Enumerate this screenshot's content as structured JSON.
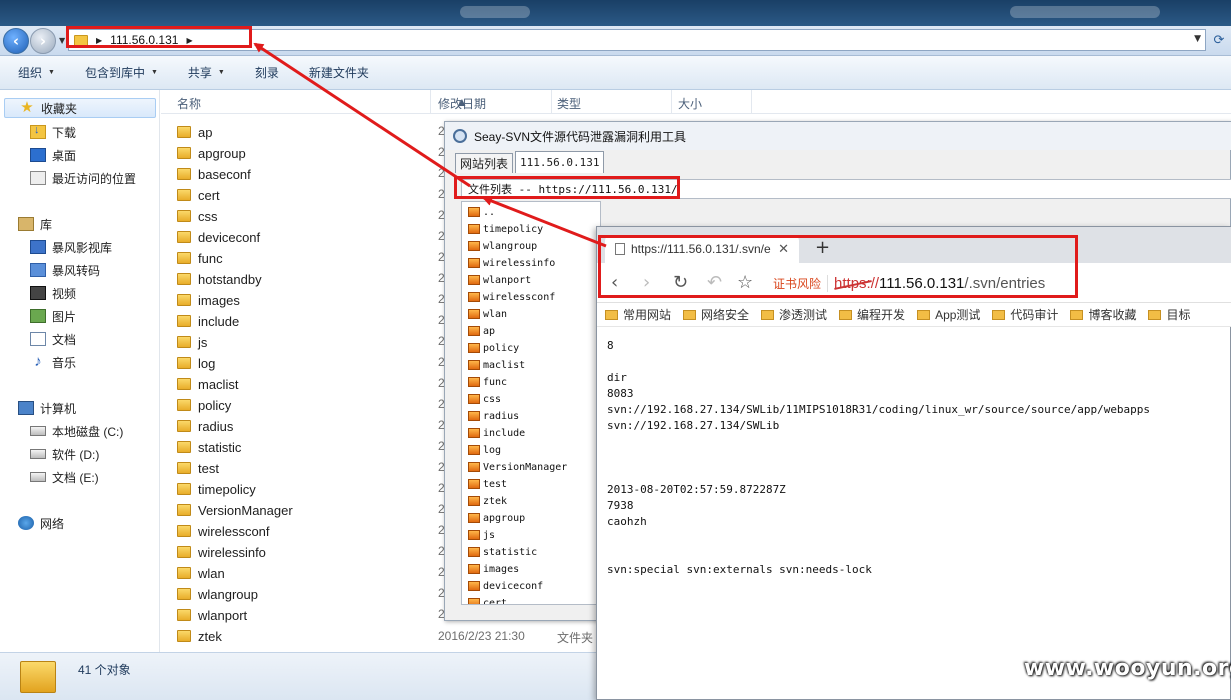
{
  "explorer": {
    "address": {
      "segments": [
        "111.56.0.131"
      ]
    },
    "toolbar": [
      {
        "label": "组织",
        "dropdown": true
      },
      {
        "label": "包含到库中",
        "dropdown": true
      },
      {
        "label": "共享",
        "dropdown": true
      },
      {
        "label": "刻录",
        "dropdown": false
      },
      {
        "label": "新建文件夹",
        "dropdown": false
      }
    ],
    "nav": {
      "favorites": "收藏夹",
      "favorites_items": [
        "下载",
        "桌面",
        "最近访问的位置"
      ],
      "libraries": "库",
      "library_items": [
        "暴风影视库",
        "暴风转码",
        "视频",
        "图片",
        "文档",
        "音乐"
      ],
      "computer": "计算机",
      "drives": [
        "本地磁盘 (C:)",
        "软件 (D:)",
        "文档 (E:)"
      ],
      "network": "网络"
    },
    "columns": [
      "名称",
      "修改日期",
      "类型",
      "大小"
    ],
    "files": [
      "ap",
      "apgroup",
      "baseconf",
      "cert",
      "css",
      "deviceconf",
      "func",
      "hotstandby",
      "images",
      "include",
      "js",
      "log",
      "maclist",
      "policy",
      "radius",
      "statistic",
      "test",
      "timepolicy",
      "VersionManager",
      "wirelessconf",
      "wirelessinfo",
      "wlan",
      "wlangroup",
      "wlanport",
      "ztek"
    ],
    "date_partial": "2",
    "last_row": {
      "date": "2016/2/23 21:30",
      "type": "文件夹"
    },
    "status": "41 个对象"
  },
  "seay": {
    "title": "Seay-SVN文件源代码泄露漏洞利用工具",
    "tabs": [
      "网站列表",
      "111.56.0.131"
    ],
    "path": "文件列表 -- https://111.56.0.131/",
    "items": [
      "..",
      "timepolicy",
      "wlangroup",
      "wirelessinfo",
      "wlanport",
      "wirelessconf",
      "wlan",
      "ap",
      "policy",
      "maclist",
      "func",
      "css",
      "radius",
      "include",
      "log",
      "VersionManager",
      "test",
      "ztek",
      "apgroup",
      "js",
      "statistic",
      "images",
      "deviceconf",
      "cert"
    ]
  },
  "browser": {
    "tab_title": "https://111.56.0.131/.svn/e",
    "cert_warning": "证书风险",
    "url": {
      "proto": "https://",
      "host": "111.56.0.131",
      "path": "/.svn/entries"
    },
    "bookmarks": [
      "常用网站",
      "网络安全",
      "渗透测试",
      "编程开发",
      "App测试",
      "代码审计",
      "博客收藏",
      "目标"
    ],
    "content": [
      "8",
      "dir",
      "8083",
      "svn://192.168.27.134/SWLib/11MIPS1018R31/coding/linux_wr/source/source/app/webapps",
      "svn://192.168.27.134/SWLib",
      "2013-08-20T02:57:59.872287Z",
      "7938",
      "caohzh",
      "svn:special svn:externals svn:needs-lock"
    ]
  },
  "watermark": "www.wooyun.org",
  "colors": {
    "annotation": "#e01b1b",
    "accent": "#1e395b"
  }
}
